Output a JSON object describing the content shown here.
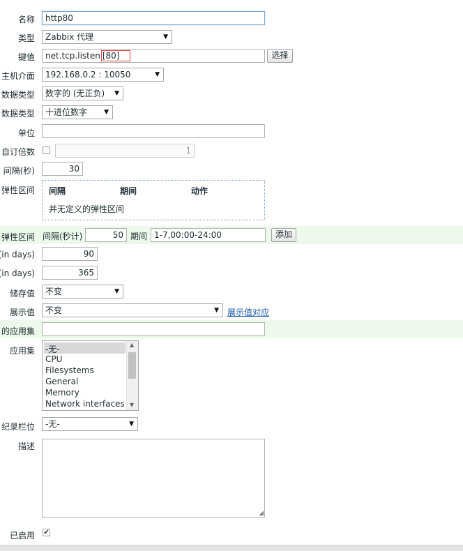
{
  "name": {
    "label": "名称",
    "value": "http80"
  },
  "type": {
    "label": "类型",
    "value": "Zabbix 代理"
  },
  "key": {
    "label": "键值",
    "value_prefix": "net.tcp.listen",
    "value_highlight": "[80]",
    "select_button": "选择"
  },
  "host_interface": {
    "label": "主机介面",
    "value": "192.168.0.2 : 10050"
  },
  "info_type": {
    "label": "数据类型",
    "value": "数字的 (无正负)"
  },
  "data_type": {
    "label": "数据类型",
    "value": "十进位数字"
  },
  "units": {
    "label": "单位",
    "value": ""
  },
  "multiplier": {
    "label": "自订倍数",
    "value": "1",
    "checked": false
  },
  "update_interval": {
    "label": "间隔(秒)",
    "value": "30"
  },
  "flex_intervals": {
    "label": "弹性区间",
    "headers": [
      "间隔",
      "期间",
      "动作"
    ],
    "empty_text": "并无定义的弹性区间"
  },
  "new_flex": {
    "label": "弹性区间",
    "interval_label": "间隔(秒计)",
    "interval_value": "50",
    "period_label": "期间",
    "period_value": "1-7,00:00-24:00",
    "add_button": "添加"
  },
  "history": {
    "label": "(in days)",
    "value": "90"
  },
  "trends": {
    "label": "(in days)",
    "value": "365"
  },
  "store_value": {
    "label": "储存值",
    "value": "不变"
  },
  "show_value": {
    "label": "展示值",
    "value": "不变",
    "link": "展示值对应"
  },
  "new_application": {
    "label": "的应用集",
    "value": ""
  },
  "applications": {
    "label": "应用集",
    "options": [
      "-无-",
      "CPU",
      "Filesystems",
      "General",
      "Memory",
      "Network interfaces"
    ],
    "selected_index": 0
  },
  "inventory_field": {
    "label": "纪录栏位",
    "value": "-无-"
  },
  "description": {
    "label": "描述",
    "value": ""
  },
  "enabled": {
    "label": "已启用",
    "checked": true
  },
  "colors": {
    "highlight_band": "#edf9ea",
    "focus_border": "#7aa7d6",
    "key_highlight_border": "#e04040",
    "link": "#1a59a8"
  }
}
